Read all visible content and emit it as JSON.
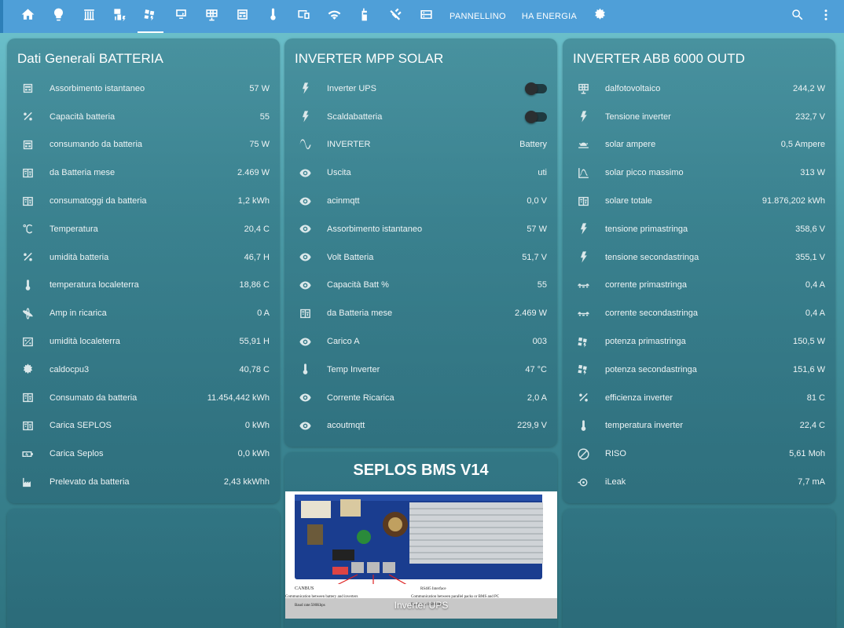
{
  "nav": {
    "tabs": [
      "home-icon",
      "lightbulb-icon",
      "radiator-icon",
      "solar-ups-icon",
      "solar-power-icon",
      "monitor-icon",
      "solar-panel-icon",
      "gauge-icon",
      "thermometer-icon",
      "devices-icon",
      "wifi-icon",
      "walkie-icon",
      "satellite-icon",
      "rack-icon"
    ],
    "text_tabs": [
      "PANNELLINO",
      "HA ENERGIA"
    ],
    "last_icon": "chip-icon",
    "search_icon": "search-icon",
    "menu_icon": "menu-icon"
  },
  "battery": {
    "title": "Dati Generali BATTERIA",
    "rows": [
      {
        "icon": "gauge-icon",
        "label": "Assorbimento istantaneo",
        "value": "57 W"
      },
      {
        "icon": "percent-icon",
        "label": "Capacità batteria",
        "value": "55"
      },
      {
        "icon": "gauge-icon",
        "label": "consumando da batteria",
        "value": "75 W"
      },
      {
        "icon": "meter-icon",
        "label": "da Batteria mese",
        "value": "2.469 W"
      },
      {
        "icon": "meter-icon",
        "label": "consumatoggi da batteria",
        "value": "1,2 kWh"
      },
      {
        "icon": "celsius-icon",
        "label": "Temperatura",
        "value": "20,4 C"
      },
      {
        "icon": "percent-icon",
        "label": "umidità batteria",
        "value": "46,7 H"
      },
      {
        "icon": "thermometer-icon",
        "label": "temperatura localeterra",
        "value": "18,86 C"
      },
      {
        "icon": "atom-icon",
        "label": "Amp in ricarica",
        "value": "0 A"
      },
      {
        "icon": "percent-box-icon",
        "label": "umidità localeterra",
        "value": "55,91 H"
      },
      {
        "icon": "chip-icon",
        "label": "caldocpu3",
        "value": "40,78 C"
      },
      {
        "icon": "meter-icon",
        "label": "Consumato da batteria",
        "value": "11.454,442 kWh"
      },
      {
        "icon": "meter-icon",
        "label": "Carica SEPLOS",
        "value": "0 kWh"
      },
      {
        "icon": "battery-charging-icon",
        "label": "Carica Seplos",
        "value": "0,0 kWh"
      },
      {
        "icon": "factory-icon",
        "label": "Prelevato da batteria",
        "value": "2,43 kkWhh"
      }
    ]
  },
  "mpp": {
    "title": "INVERTER MPP SOLAR",
    "rows": [
      {
        "icon": "flash-icon",
        "label": "Inverter UPS",
        "toggle": true
      },
      {
        "icon": "flash-icon",
        "label": "Scaldabatteria",
        "toggle": true
      },
      {
        "icon": "sine-wave-icon",
        "label": "INVERTER",
        "value": "Battery"
      },
      {
        "icon": "eye-icon",
        "label": "Uscita",
        "value": "uti"
      },
      {
        "icon": "eye-icon",
        "label": "acinmqtt",
        "value": "0,0 V"
      },
      {
        "icon": "eye-icon",
        "label": "Assorbimento istantaneo",
        "value": "57 W"
      },
      {
        "icon": "eye-icon",
        "label": "Volt Batteria",
        "value": "51,7 V"
      },
      {
        "icon": "eye-icon",
        "label": "Capacità Batt %",
        "value": "55"
      },
      {
        "icon": "meter-icon",
        "label": "da Batteria mese",
        "value": "2.469 W"
      },
      {
        "icon": "eye-icon",
        "label": "Carico A",
        "value": "003"
      },
      {
        "icon": "thermometer-icon",
        "label": "Temp Inverter",
        "value": "47 °C"
      },
      {
        "icon": "eye-icon",
        "label": "Corrente Ricarica",
        "value": "2,0 A"
      },
      {
        "icon": "eye-icon",
        "label": "acoutmqtt",
        "value": "229,9 V"
      }
    ]
  },
  "abb": {
    "title": "INVERTER ABB 6000 OUTD",
    "rows": [
      {
        "icon": "solar-panel-icon",
        "label": "dalfotovoltaico",
        "value": "244,2 W"
      },
      {
        "icon": "flash-icon",
        "label": "Tensione inverter",
        "value": "232,7 V"
      },
      {
        "icon": "sun-low-icon",
        "label": "solar ampere",
        "value": "0,5 Ampere"
      },
      {
        "icon": "chart-bell-icon",
        "label": "solar picco massimo",
        "value": "313 W"
      },
      {
        "icon": "meter-icon",
        "label": "solare totale",
        "value": "91.876,202 kWh"
      },
      {
        "icon": "flash-icon",
        "label": "tensione primastringa",
        "value": "358,6 V"
      },
      {
        "icon": "flash-icon",
        "label": "tensione secondastringa",
        "value": "355,1 V"
      },
      {
        "icon": "current-dc-icon",
        "label": "corrente primastringa",
        "value": "0,4 A"
      },
      {
        "icon": "current-dc-icon",
        "label": "corrente secondastringa",
        "value": "0,4 A"
      },
      {
        "icon": "solar-power-icon",
        "label": "potenza primastringa",
        "value": "150,5 W"
      },
      {
        "icon": "solar-power-icon",
        "label": "potenza secondastringa",
        "value": "151,6 W"
      },
      {
        "icon": "percent-icon",
        "label": "efficienza inverter",
        "value": "81 C"
      },
      {
        "icon": "thermometer-icon",
        "label": "temperatura inverter",
        "value": "22,4 C"
      },
      {
        "icon": "omega-icon",
        "label": "RISO",
        "value": "5,61 Moh"
      },
      {
        "icon": "leak-icon",
        "label": "iLeak",
        "value": "7,7 mA"
      }
    ]
  },
  "bms": {
    "title": "SEPLOS BMS V14",
    "caption": "Inverter UPS",
    "board_labels": {
      "canbus": "CANBUS",
      "canbus_desc": "Communication between battery and inverters",
      "canbus_baud": "Baud rate:500Kbps",
      "rs485": "RS485 Interface",
      "rs485_desc": "Communication between parallel packs or BMS and PC",
      "rs485_baud": "Baud rate:19200bps"
    }
  }
}
